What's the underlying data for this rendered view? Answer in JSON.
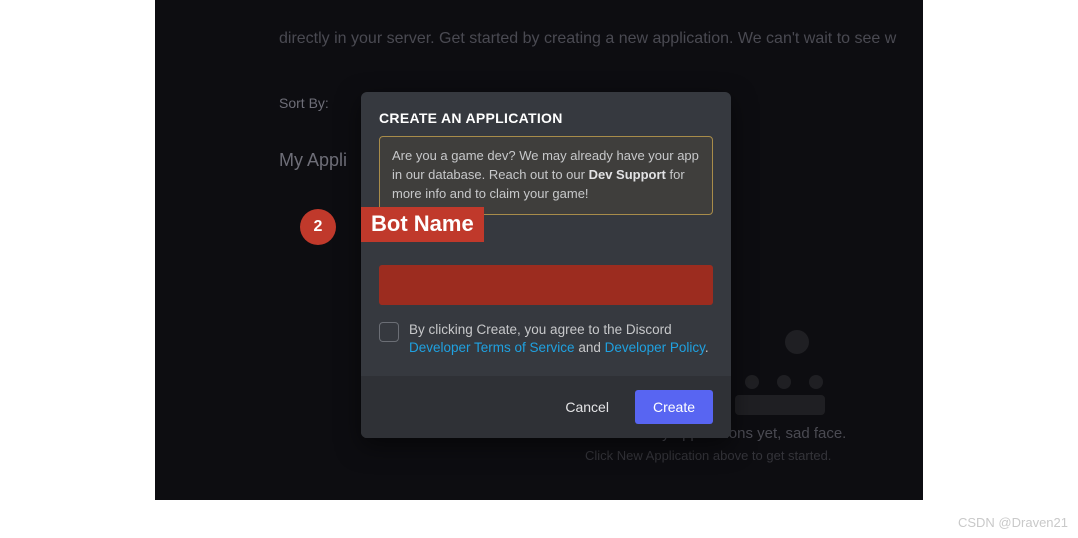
{
  "background": {
    "intro_text": "directly in your server. Get started by creating a new application. We can't wait to see w",
    "sort_by_label": "Sort By:",
    "my_apps_label": "My Appli",
    "empty_title": "You don't have any applications yet, sad face.",
    "empty_subtitle": "Click New Application above to get started."
  },
  "modal": {
    "title": "CREATE AN APPLICATION",
    "info_prefix": "Are you a game dev? We may already have your app in our database. Reach out to our ",
    "info_bold": "Dev Support",
    "info_suffix": " for more info and to claim your game!",
    "name_value": "",
    "agree_prefix": "By clicking Create, you agree to the Discord ",
    "agree_link1": "Developer Terms of Service",
    "agree_mid": " and ",
    "agree_link2": "Developer Policy",
    "agree_end": ".",
    "cancel_label": "Cancel",
    "create_label": "Create"
  },
  "annotation": {
    "step_number": "2",
    "label": "Bot Name"
  },
  "watermark": "CSDN @Draven21"
}
